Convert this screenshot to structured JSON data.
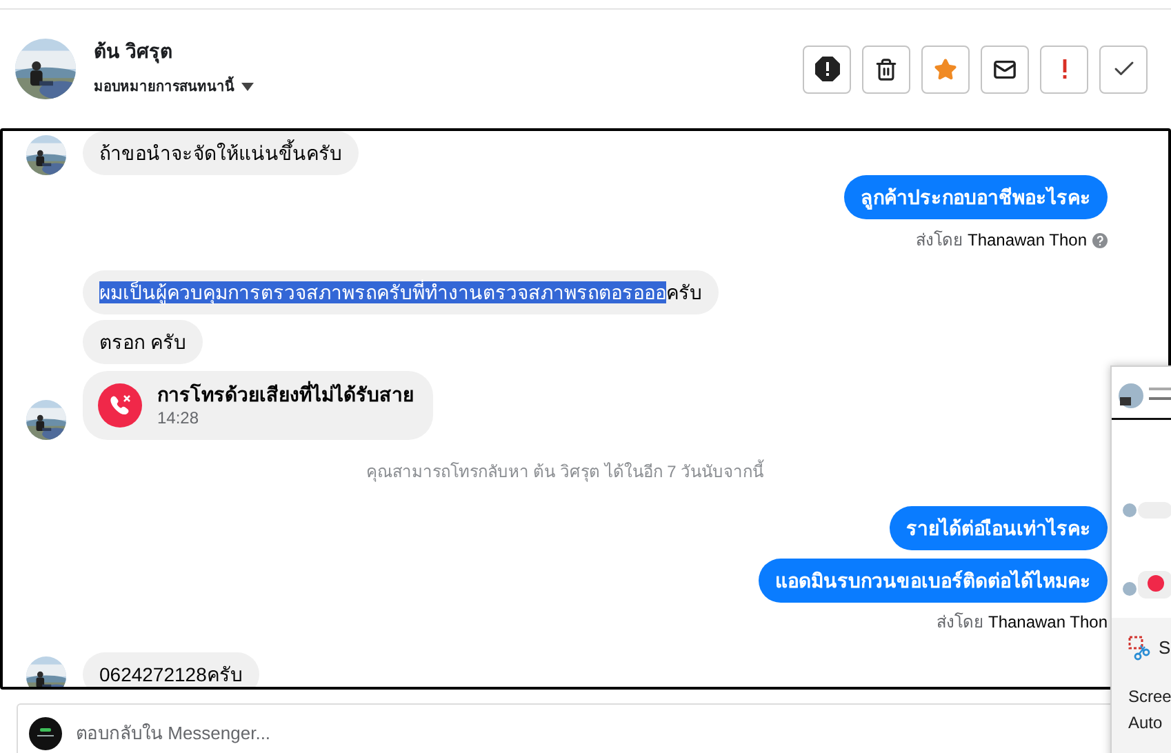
{
  "contact": {
    "name": "ต้น วิศรุต",
    "assign_label": "มอบหมายการสนทนานี้"
  },
  "messages": [
    {
      "kind": "received",
      "text": "ถ้าขอนำจะจัดให้แน่นขึ้นครับ",
      "avatar": true
    },
    {
      "kind": "sent",
      "text": "ลูกค้าประกอบอาชีพอะไรคะ"
    },
    {
      "kind": "sender",
      "prefix": "ส่งโดย",
      "name": "Thanawan Thon",
      "help": true
    },
    {
      "kind": "received",
      "highlighted": "ผมเป็นผู้ควบคุมการตรวจสภาพรถครับพี่ทำงานตรวจสภาพรถตอรอออ",
      "text": "ครับ",
      "avatar": false
    },
    {
      "kind": "received",
      "text": "ตรอก ครับ",
      "avatar": false
    },
    {
      "kind": "call",
      "text": "การโทรด้วยเสียงที่ไม่ได้รับสาย",
      "time": "14:28",
      "avatar": true
    },
    {
      "kind": "notice",
      "text": "คุณสามารถโทรกลับหา ต้น วิศรุต ได้ในอีก 7 วันนับจากนี้"
    },
    {
      "kind": "sent",
      "text": "รายได้ต่อเือนเท่าไรคะ"
    },
    {
      "kind": "sent",
      "text": "แอดมินรบกวนขอเบอร์ติดต่อได้ไหมคะ"
    },
    {
      "kind": "sender",
      "prefix": "ส่งโดย",
      "name": "Thanawan Thon",
      "help": false
    },
    {
      "kind": "received",
      "text": "0624272128ครับ",
      "avatar": true
    }
  ],
  "composer": {
    "placeholder": "ตอบกลับใน Messenger..."
  },
  "snip_popup": {
    "title": "S",
    "lines": [
      "Scree",
      "Auto"
    ]
  }
}
